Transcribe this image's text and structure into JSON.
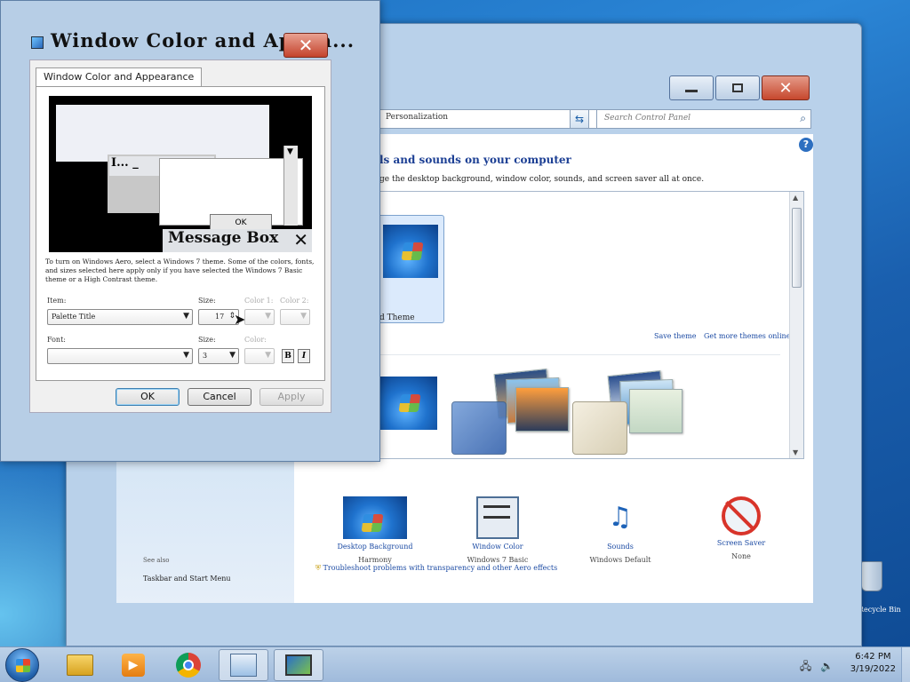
{
  "personalization": {
    "address": "Personalization",
    "search_placeholder": "Search Control Panel",
    "heading": "ls and sounds on your computer",
    "subheading": "ge the desktop background, window color, sounds, and screen saver all at once.",
    "selected_theme_label": "d Theme",
    "save_theme_link": "Save theme",
    "get_more_link": "Get more themes online",
    "see_also": "See also",
    "taskbar_link": "Taskbar and Start Menu",
    "troubleshoot_link": "Troubleshoot problems with transparency and other Aero effects",
    "bottom_items": [
      {
        "label": "Desktop Background",
        "value": "Harmony"
      },
      {
        "label": "Window Color",
        "value": "Windows 7 Basic"
      },
      {
        "label": "Sounds",
        "value": "Windows Default"
      },
      {
        "label": "Screen Saver",
        "value": "None"
      }
    ]
  },
  "dialog": {
    "title": "Window Color and Appea...",
    "tab": "Window Color and Appearance",
    "preview": {
      "inactive_title": "I...",
      "message_box_title": "Message Box",
      "ok": "OK"
    },
    "description": "To turn on Windows Aero, select a Windows 7 theme.  Some of the colors, fonts, and sizes selected here apply only if you have selected the Windows 7 Basic theme or a High Contrast theme.",
    "item_label": "Item:",
    "item_value": "Palette Title",
    "size_label": "Size:",
    "size_value": "17",
    "color1_label": "Color 1:",
    "color2_label": "Color 2:",
    "font_label": "Font:",
    "font_value": "",
    "font_size_label": "Size:",
    "font_size_value": "3",
    "font_color_label": "Color:",
    "bold": "B",
    "italic": "I",
    "buttons": {
      "ok": "OK",
      "cancel": "Cancel",
      "apply": "Apply"
    }
  },
  "taskbar": {
    "time": "6:42 PM",
    "date": "3/19/2022"
  },
  "desktop": {
    "recycle_bin_label": "Recycle Bin"
  },
  "colors": {
    "link": "#1b4aa3",
    "window_frame": "#b9d1ea",
    "close_red": "#c6472d"
  }
}
